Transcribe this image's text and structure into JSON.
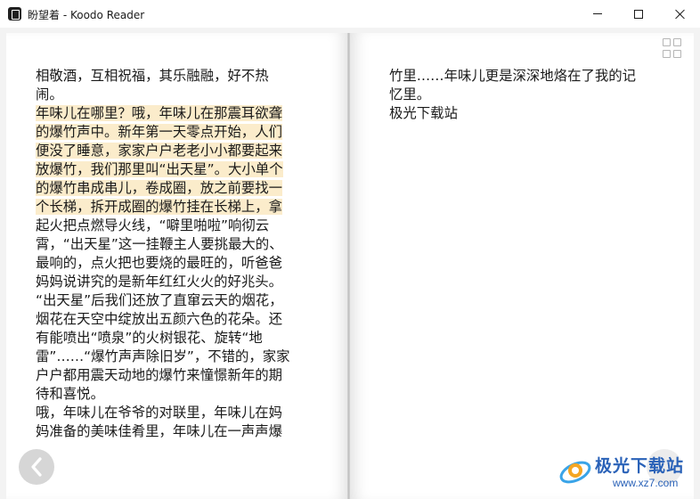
{
  "window": {
    "title": "盼望着 - Koodo Reader",
    "controls": [
      "minimize",
      "maximize",
      "close"
    ]
  },
  "book": {
    "left_page_lines": [
      {
        "text": "相敬酒，互相祝福，其乐融融，好不热",
        "highlight": false
      },
      {
        "text": "闹。",
        "highlight": false
      },
      {
        "text": "年味儿在哪里？哦，年味儿在那震耳欲聋",
        "highlight": true
      },
      {
        "text": "的爆竹声中。新年第一天零点开始，人们",
        "highlight": true
      },
      {
        "text": "便没了睡意，家家户户老老小小都要起来",
        "highlight": true
      },
      {
        "text": "放爆竹，我们那里叫“出天星”。大小单个",
        "highlight": true
      },
      {
        "text": "的爆竹串成串儿，卷成圈，放之前要找一",
        "highlight": true
      },
      {
        "text": "个长梯，拆开成圈的爆竹挂在长梯上，拿",
        "highlight": true
      },
      {
        "text": "起火把点燃导火线，“噼里啪啦”响彻云",
        "highlight": false
      },
      {
        "text": "霄，“出天星”这一挂鞭主人要挑最大的、",
        "highlight": false
      },
      {
        "text": "最响的，点火把也要烧的最旺的，听爸爸",
        "highlight": false
      },
      {
        "text": "妈妈说讲究的是新年红红火火的好兆头。",
        "highlight": false
      },
      {
        "text": "“出天星”后我们还放了直窜云天的烟花，",
        "highlight": false
      },
      {
        "text": "烟花在天空中绽放出五颜六色的花朵。还",
        "highlight": false
      },
      {
        "text": "有能喷出“喷泉”的火树银花、旋转“地",
        "highlight": false
      },
      {
        "text": "雷”……“爆竹声声除旧岁”，不错的，家家",
        "highlight": false
      },
      {
        "text": "户户都用震天动地的爆竹来憧憬新年的期",
        "highlight": false
      },
      {
        "text": "待和喜悦。",
        "highlight": false
      },
      {
        "text": "哦，年味儿在爷爷的对联里，年味儿在妈",
        "highlight": false
      },
      {
        "text": "妈准备的美味佳肴里，年味儿在一声声爆",
        "highlight": false
      }
    ],
    "right_page_lines": [
      {
        "text": "竹里……年味儿更是深深地烙在了我的记",
        "highlight": false
      },
      {
        "text": "忆里。",
        "highlight": false
      },
      {
        "text": "极光下载站",
        "highlight": false
      }
    ]
  },
  "colors": {
    "highlight": "#fbeccb",
    "watermark_blue": "#2a62b8"
  },
  "icons": {
    "grid": "grid-view-icon",
    "prev": "chevron-left-icon"
  },
  "watermark": {
    "name": "极光下载站",
    "url": "www.xz7.com"
  }
}
